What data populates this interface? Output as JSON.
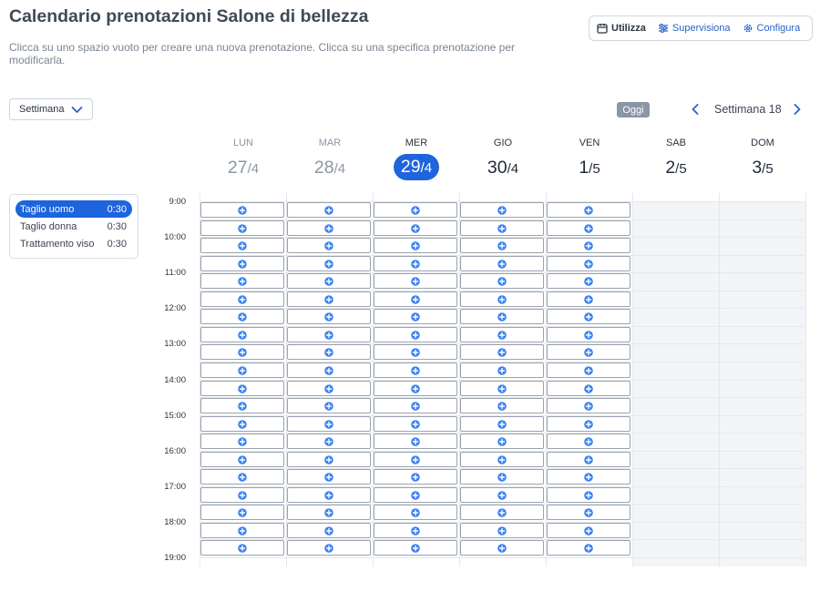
{
  "header": {
    "title": "Calendario prenotazioni Salone di bellezza",
    "subtitle": "Clicca su uno spazio vuoto per creare una nuova prenotazione. Clicca su una specifica prenotazione per modificarla."
  },
  "modes": [
    {
      "label": "Utilizza",
      "icon": "calendar-icon",
      "active": true
    },
    {
      "label": "Supervisiona",
      "icon": "sliders-icon",
      "active": false
    },
    {
      "label": "Configura",
      "icon": "gear-icon",
      "active": false
    }
  ],
  "view_select": {
    "value": "Settimana"
  },
  "nav": {
    "today_label": "Oggi",
    "week_label": "Settimana 18"
  },
  "services": [
    {
      "name": "Taglio uomo",
      "duration": "0:30",
      "selected": true
    },
    {
      "name": "Taglio donna",
      "duration": "0:30",
      "selected": false
    },
    {
      "name": "Trattamento viso",
      "duration": "0:30",
      "selected": false
    }
  ],
  "days": [
    {
      "name": "LUN",
      "day": "27",
      "month": "/4",
      "state": "past"
    },
    {
      "name": "MAR",
      "day": "28",
      "month": "/4",
      "state": "past"
    },
    {
      "name": "MER",
      "day": "29",
      "month": "/4",
      "state": "today"
    },
    {
      "name": "GIO",
      "day": "30",
      "month": "/4",
      "state": "future"
    },
    {
      "name": "VEN",
      "day": "1",
      "month": "/5",
      "state": "future"
    },
    {
      "name": "SAB",
      "day": "2",
      "month": "/5",
      "state": "closed"
    },
    {
      "name": "DOM",
      "day": "3",
      "month": "/5",
      "state": "closed"
    }
  ],
  "times": [
    "9:00",
    "10:00",
    "11:00",
    "12:00",
    "13:00",
    "14:00",
    "15:00",
    "16:00",
    "17:00",
    "18:00",
    "19:00"
  ],
  "slots_per_day": 20,
  "slot_icon": "plus-circle-icon",
  "colors": {
    "accent": "#1e64dc",
    "slot_icon": "#3b82f6",
    "closed_bg": "#f2f4f7",
    "today_chip": "#8a96a6"
  }
}
